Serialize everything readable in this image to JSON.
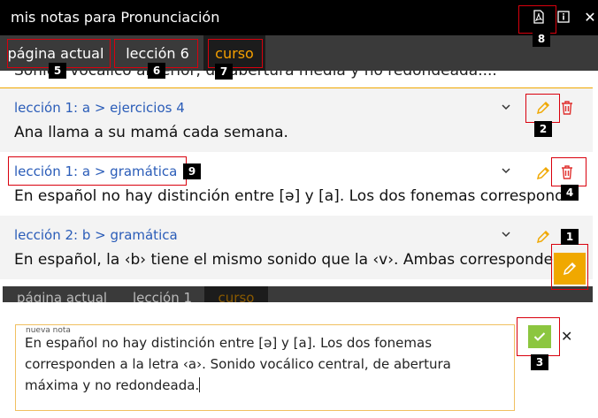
{
  "window": {
    "title": "mis notas para Pronunciación"
  },
  "tabs": {
    "current_page": "página actual",
    "lesson": "lección 6",
    "course": "curso"
  },
  "peek_line": "Sonido vocálico anterior, de abertura media y no redondeada....",
  "notes": [
    {
      "crumb": "lección 1: a > ejercicios 4",
      "text": "Ana llama a su mamá cada semana."
    },
    {
      "crumb": "lección 1: a > gramática",
      "text": "En español no hay distinción entre [ə] y [a]. Los dos fonemas corresponden a la letra ‹a›."
    },
    {
      "crumb": "lección 2: b > gramática",
      "text": "En español, la ‹b› tiene el mismo sonido que la ‹v›. Ambas corresponden al fonema /b/."
    }
  ],
  "editor_tabs": {
    "current_page": "página actual",
    "lesson": "lección 1",
    "course": "curso"
  },
  "editor": {
    "label": "nueva nota",
    "text": "En español no hay distinción entre [ə] y [a]. Los dos fonemas corresponden a la letra ‹a›. Sonido vocálico central, de abertura máxima y no redondeada."
  },
  "badges": [
    "1",
    "2",
    "3",
    "4",
    "5",
    "6",
    "7",
    "8",
    "9"
  ],
  "colors": {
    "accent": "#f0a800",
    "link": "#2a5cb8",
    "save": "#8cc63f",
    "highlight": "#d9000d"
  }
}
